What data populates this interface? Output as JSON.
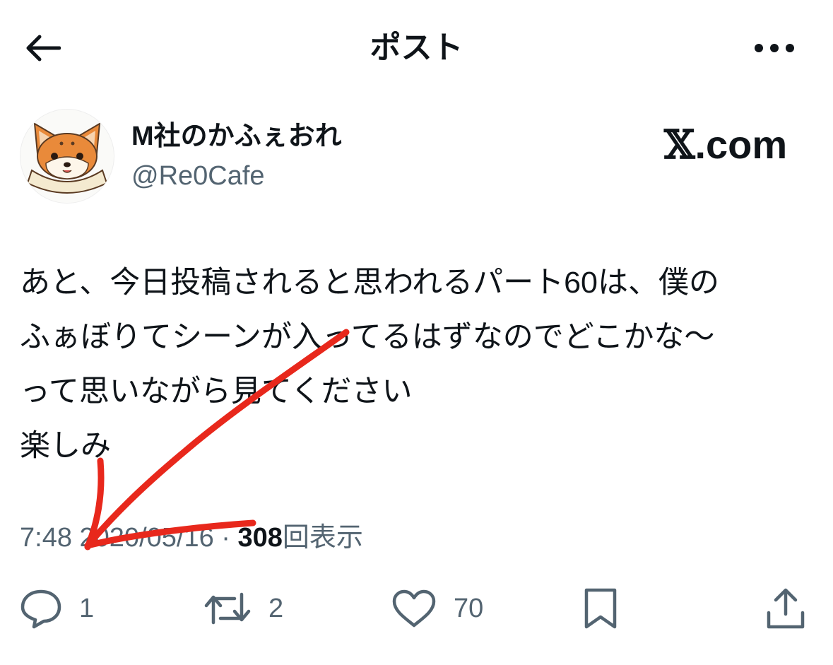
{
  "header": {
    "title": "ポスト",
    "back_icon": "arrow-left-icon",
    "more_icon": "more-horizontal-icon"
  },
  "author": {
    "display_name": "M社のかふぇおれ",
    "handle": "@Re0Cafe",
    "avatar": "fox-avatar"
  },
  "watermark": {
    "x_letter": "𝕏",
    "text": ".com"
  },
  "tweet": {
    "lines": [
      "あと、今日投稿されると思われるパート60は、僕の",
      "ふぁぼりてシーンが入ってるはずなのでどこかな〜",
      "って思いながら見てください",
      "楽しみ"
    ]
  },
  "meta": {
    "time": "7:48",
    "date": "2020/05/16",
    "separator": "·",
    "views_count": "308",
    "views_label": "回表示"
  },
  "actions": {
    "reply": {
      "icon": "reply-icon",
      "count": "1"
    },
    "repost": {
      "icon": "repost-icon",
      "count": "2"
    },
    "like": {
      "icon": "heart-icon",
      "count": "70"
    },
    "bookmark": {
      "icon": "bookmark-icon"
    },
    "share": {
      "icon": "share-icon"
    }
  },
  "colors": {
    "text_primary": "#0f1419",
    "text_secondary": "#536471",
    "annotation_red": "#e8281c",
    "fox_orange": "#e98a3a"
  }
}
